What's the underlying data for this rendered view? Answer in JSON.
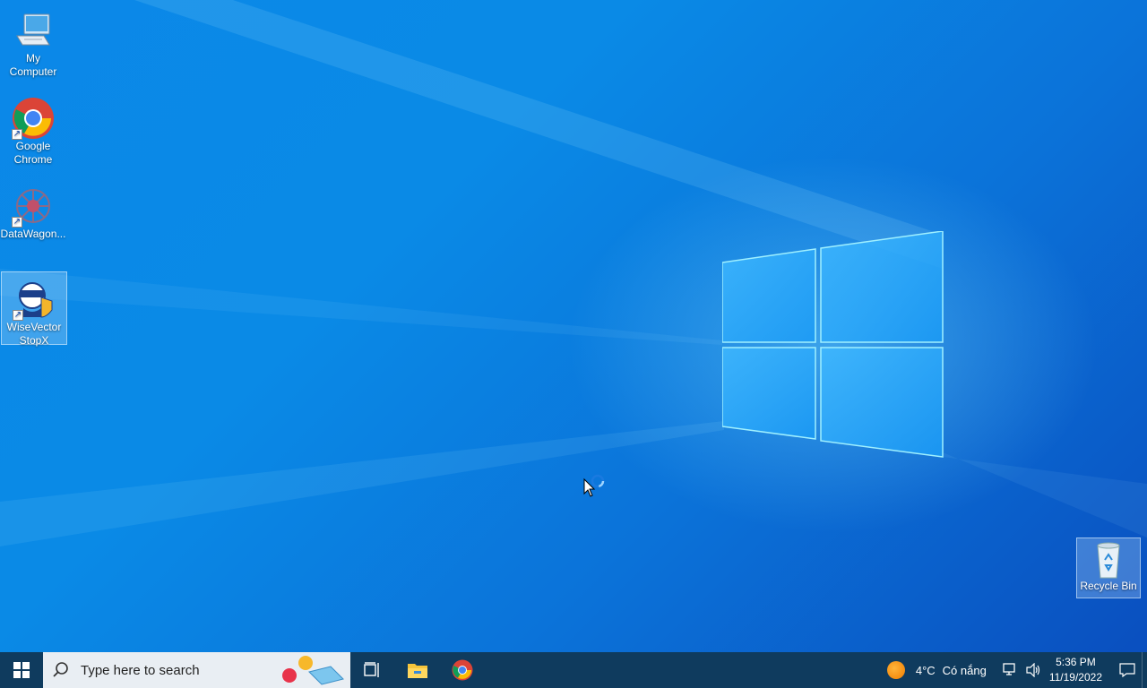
{
  "desktop": {
    "icons": [
      {
        "label": "My\nComputer",
        "icon": "computer-icon"
      },
      {
        "label": "Google\nChrome",
        "icon": "chrome-icon"
      },
      {
        "label": "DataWagon...",
        "icon": "datawagon-icon"
      },
      {
        "label": "WiseVector\nStopX",
        "icon": "wisevector-icon"
      },
      {
        "label": "Recycle Bin",
        "icon": "recycle-bin-icon"
      }
    ]
  },
  "taskbar": {
    "search_placeholder": "Type here to search",
    "pinned": [
      "task-view-icon",
      "file-explorer-icon",
      "chrome-icon"
    ],
    "weather": {
      "temp": "4°C",
      "condition": "Có nắng"
    },
    "clock": {
      "time": "5:36 PM",
      "date": "11/19/2022"
    }
  },
  "colors": {
    "taskbar": "#0f3b5e",
    "desktop_blue": "#0a8ae6",
    "search_bg": "#e9eef3"
  }
}
